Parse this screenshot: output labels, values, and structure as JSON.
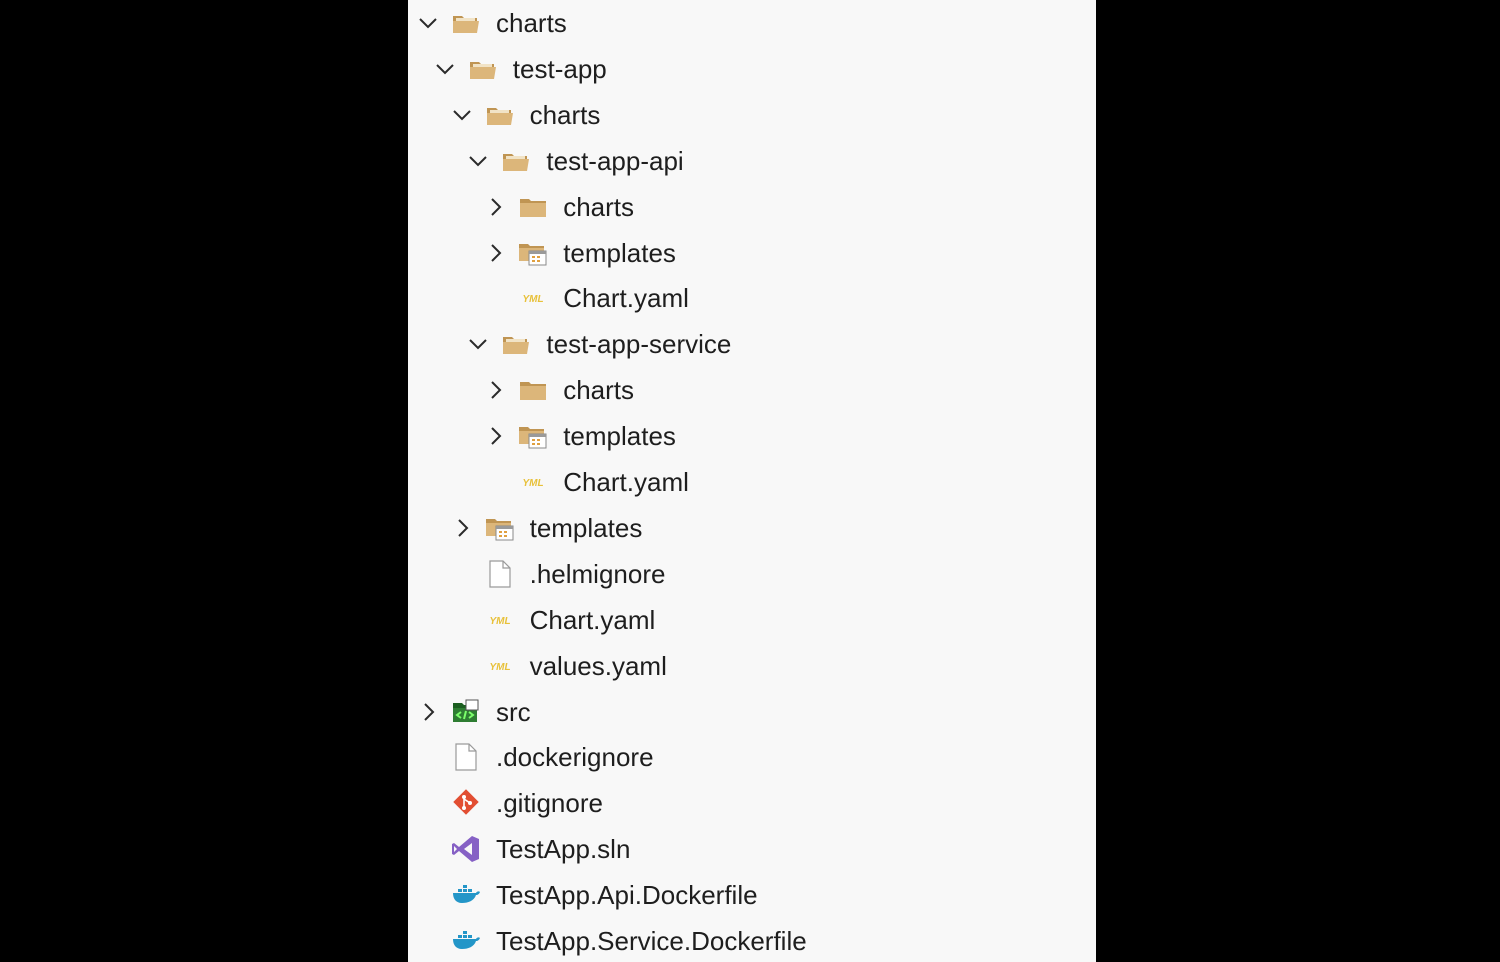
{
  "explorer": {
    "items": [
      {
        "label": "charts",
        "depth": 0,
        "chevron": "down",
        "icon": "folder-open-icon"
      },
      {
        "label": "test-app",
        "depth": 1,
        "chevron": "down",
        "icon": "folder-open-icon"
      },
      {
        "label": "charts",
        "depth": 2,
        "chevron": "down",
        "icon": "folder-open-icon"
      },
      {
        "label": "test-app-api",
        "depth": 3,
        "chevron": "down",
        "icon": "folder-open-icon"
      },
      {
        "label": "charts",
        "depth": 4,
        "chevron": "right",
        "icon": "folder-icon"
      },
      {
        "label": "templates",
        "depth": 4,
        "chevron": "right",
        "icon": "templates-folder-icon"
      },
      {
        "label": "Chart.yaml",
        "depth": 4,
        "chevron": "none",
        "icon": "yaml-file-icon"
      },
      {
        "label": "test-app-service",
        "depth": 3,
        "chevron": "down",
        "icon": "folder-open-icon"
      },
      {
        "label": "charts",
        "depth": 4,
        "chevron": "right",
        "icon": "folder-icon"
      },
      {
        "label": "templates",
        "depth": 4,
        "chevron": "right",
        "icon": "templates-folder-icon"
      },
      {
        "label": "Chart.yaml",
        "depth": 4,
        "chevron": "none",
        "icon": "yaml-file-icon"
      },
      {
        "label": "templates",
        "depth": 2,
        "chevron": "right",
        "icon": "templates-folder-icon"
      },
      {
        "label": ".helmignore",
        "depth": 2,
        "chevron": "none",
        "icon": "file-icon"
      },
      {
        "label": "Chart.yaml",
        "depth": 2,
        "chevron": "none",
        "icon": "yaml-file-icon"
      },
      {
        "label": "values.yaml",
        "depth": 2,
        "chevron": "none",
        "icon": "yaml-file-icon"
      },
      {
        "label": "src",
        "depth": 0,
        "chevron": "right",
        "icon": "source-folder-icon"
      },
      {
        "label": ".dockerignore",
        "depth": 0,
        "chevron": "none",
        "icon": "file-icon"
      },
      {
        "label": ".gitignore",
        "depth": 0,
        "chevron": "none",
        "icon": "git-icon"
      },
      {
        "label": "TestApp.sln",
        "depth": 0,
        "chevron": "none",
        "icon": "visual-studio-icon"
      },
      {
        "label": "TestApp.Api.Dockerfile",
        "depth": 0,
        "chevron": "none",
        "icon": "docker-icon"
      },
      {
        "label": "TestApp.Service.Dockerfile",
        "depth": 0,
        "chevron": "none",
        "icon": "docker-icon"
      }
    ],
    "yaml_icon_text": "YML"
  },
  "colors": {
    "panel_background": "#f8f8f8",
    "outside_background": "#000000",
    "text": "#1e1e1e",
    "folder": "#dcb67a",
    "folder_dark": "#c09553",
    "yaml": "#e8c13a",
    "git": "#e24e32",
    "visual_studio": "#8661c5",
    "docker": "#2496c8",
    "source_folder": "#2e7d32"
  }
}
